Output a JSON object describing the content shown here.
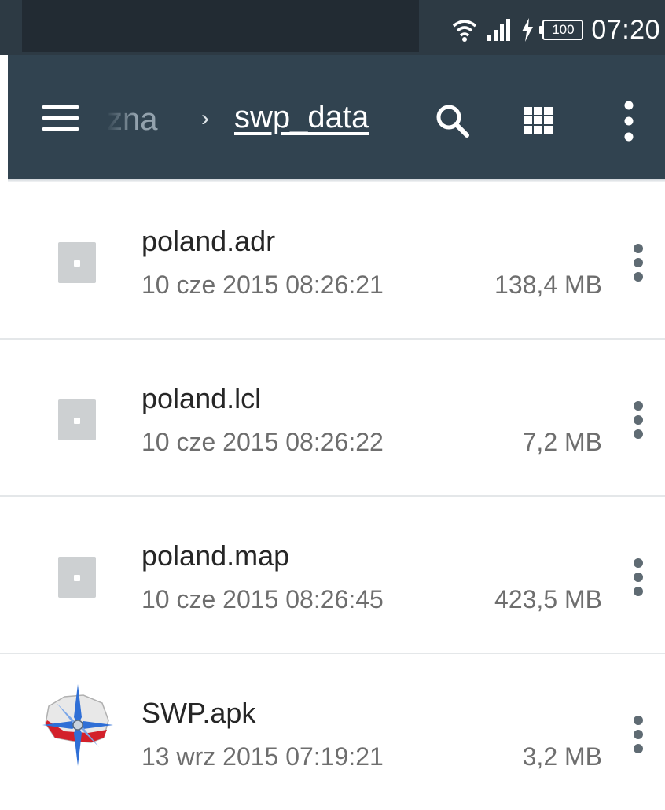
{
  "status_bar": {
    "time": "07:20",
    "battery_level": "100",
    "icons": [
      "wifi-icon",
      "signal-icon",
      "charging-icon",
      "battery-icon"
    ]
  },
  "toolbar": {
    "breadcrumb_prev": "zna",
    "breadcrumb_separator": "›",
    "breadcrumb_current": "swp_data",
    "icons": [
      "menu-icon",
      "search-icon",
      "grid-view-icon",
      "more-vert-icon"
    ],
    "background_color": "#314350"
  },
  "files": [
    {
      "name": "poland.adr",
      "date": "10 cze 2015 08:26:21",
      "size": "138,4 MB",
      "icon": "generic-file-icon"
    },
    {
      "name": "poland.lcl",
      "date": "10 cze 2015 08:26:22",
      "size": "7,2 MB",
      "icon": "generic-file-icon"
    },
    {
      "name": "poland.map",
      "date": "10 cze 2015 08:26:45",
      "size": "423,5 MB",
      "icon": "generic-file-icon"
    },
    {
      "name": "SWP.apk",
      "date": "13 wrz 2015 07:19:21",
      "size": "3,2 MB",
      "icon": "swp-app-icon"
    }
  ]
}
